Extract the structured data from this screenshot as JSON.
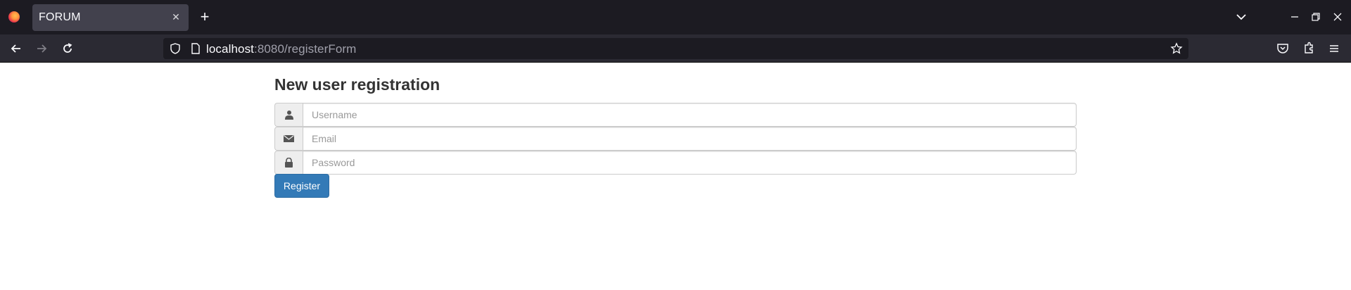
{
  "browser": {
    "tab_title": "FORUM",
    "tab_close_icon": "close-icon",
    "new_tab_icon": "plus-icon",
    "url_host": "localhost",
    "url_rest": ":8080/registerForm"
  },
  "page": {
    "heading": "New user registration",
    "fields": [
      {
        "icon": "user-icon",
        "placeholder": "Username",
        "value": ""
      },
      {
        "icon": "envelope-icon",
        "placeholder": "Email",
        "value": ""
      },
      {
        "icon": "lock-icon",
        "placeholder": "Password",
        "value": ""
      }
    ],
    "register_label": "Register",
    "colors": {
      "primary": "#337ab7",
      "chrome_dark": "#1c1b22",
      "chrome_mid": "#2b2a33"
    }
  }
}
